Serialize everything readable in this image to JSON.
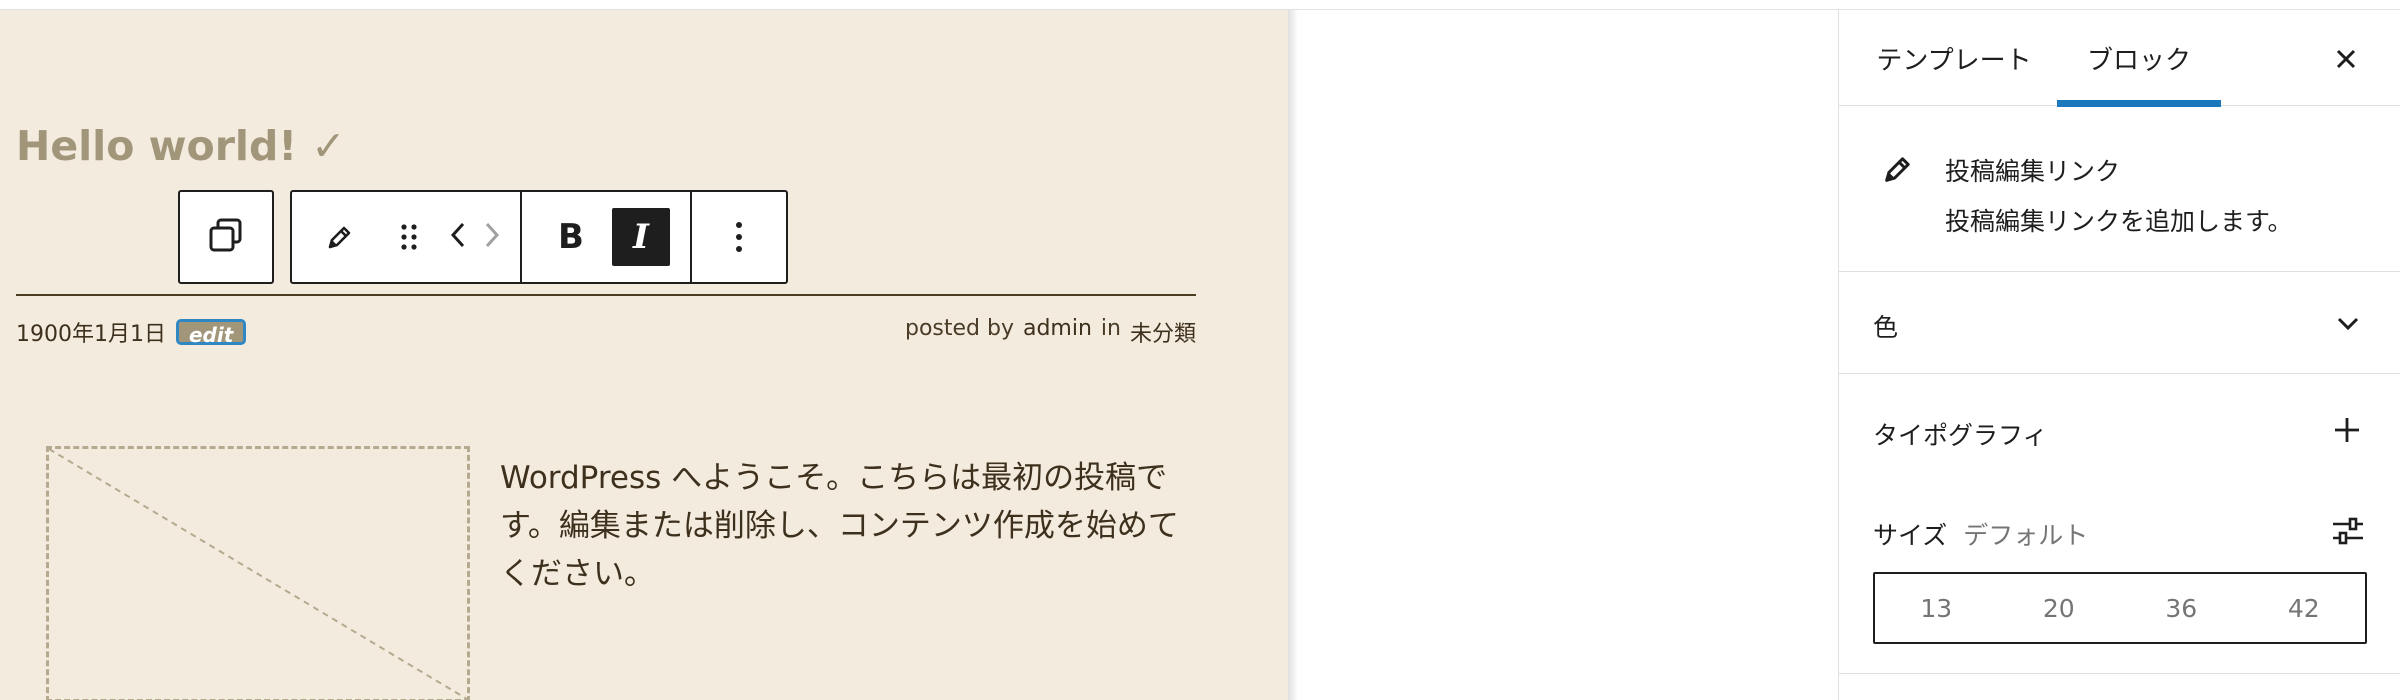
{
  "editor": {
    "post_title": "Hello world! ✓",
    "meta": {
      "date": "1900年1月1日",
      "edit_link": "edit",
      "posted_by": "posted by",
      "author": "admin",
      "in": "in",
      "category": "未分類"
    },
    "excerpt": "WordPress へようこそ。こちらは最初の投稿です。編集または削除し、コンテンツ作成を始めてください。",
    "toolbar": {
      "transform_icon": "duplicate-squares-icon",
      "edit_icon": "pencil-icon",
      "drag_icon": "drag-handle-icon",
      "move_left_icon": "chevron-left-icon",
      "move_right_icon": "chevron-right-icon",
      "bold_label": "B",
      "italic_label": "I",
      "options_icon": "more-vertical-icon"
    }
  },
  "sidebar": {
    "tabs": [
      {
        "label": "テンプレート",
        "active": false
      },
      {
        "label": "ブロック",
        "active": true
      }
    ],
    "close_icon": "close-icon",
    "block_card": {
      "icon": "pencil-icon",
      "title": "投稿編集リンク",
      "description": "投稿編集リンクを追加します。"
    },
    "color_panel": {
      "label": "色",
      "icon": "chevron-down-icon"
    },
    "typography_panel": {
      "label": "タイポグラフィ",
      "icon": "plus-icon",
      "size_label": "サイズ",
      "size_value": "デフォルト",
      "custom_icon": "settings-sliders-icon",
      "size_options": [
        "13",
        "20",
        "36",
        "42"
      ]
    }
  },
  "colors": {
    "canvas_bg": "#f4ebdf",
    "title": "#a1957a",
    "text": "#3d301c",
    "accent": "#1c78bd"
  }
}
